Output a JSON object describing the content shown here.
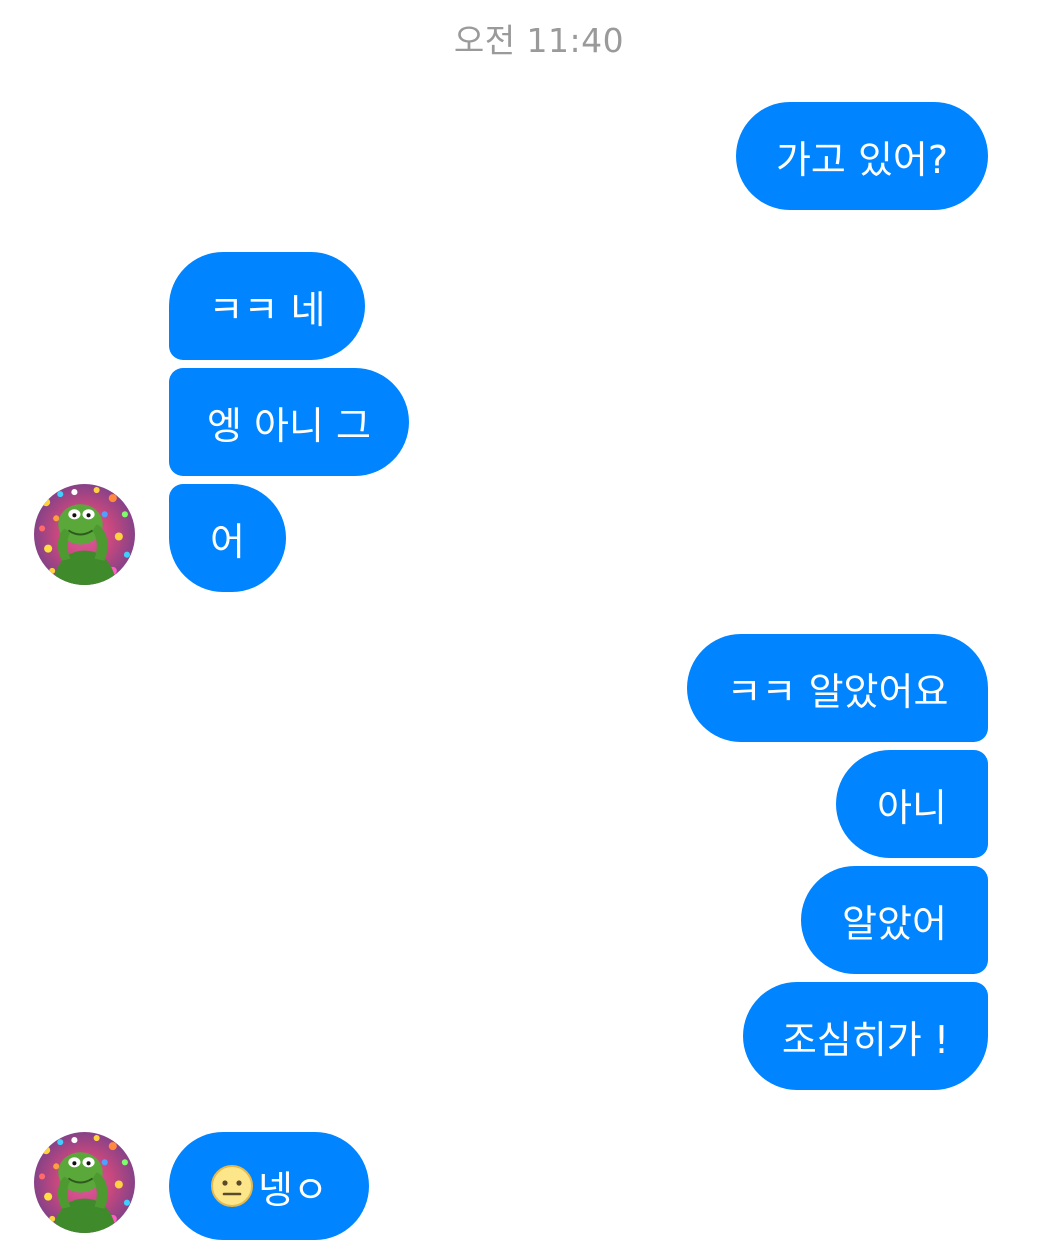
{
  "conversation": {
    "timestamp": "오전 11:40",
    "messages": [
      {
        "id": "m1",
        "from": "me",
        "text": "가고 있어?"
      },
      {
        "id": "m2",
        "from": "them",
        "text": "ㅋㅋ 네"
      },
      {
        "id": "m3",
        "from": "them",
        "text": "엥 아니 그"
      },
      {
        "id": "m4",
        "from": "them",
        "text": "어"
      },
      {
        "id": "m5",
        "from": "me",
        "text": "ㅋㅋ 알았어요"
      },
      {
        "id": "m6",
        "from": "me",
        "text": "아니"
      },
      {
        "id": "m7",
        "from": "me",
        "text": "알았어"
      },
      {
        "id": "m8",
        "from": "me",
        "text": "조심히가 !"
      },
      {
        "id": "m9",
        "from": "them",
        "text": "넹ㅇ",
        "emoji": "neutral-face-emoji"
      }
    ]
  },
  "colors": {
    "bubble": "#0084ff",
    "bubble_text": "#ffffff",
    "timestamp": "#9a9a9a",
    "background": "#ffffff"
  },
  "icons": {
    "contact_avatar": "kermit-avatar-icon"
  }
}
